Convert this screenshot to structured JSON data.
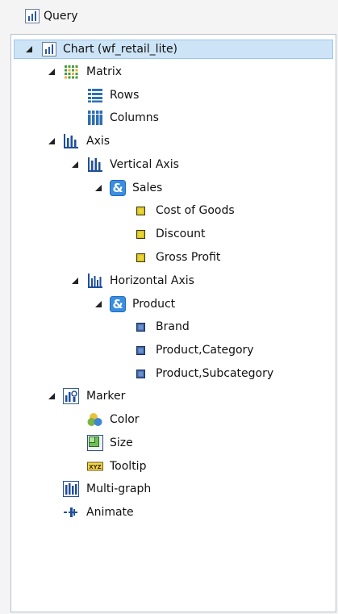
{
  "header": {
    "title": "Query"
  },
  "tree": {
    "chart": "Chart (wf_retail_lite)",
    "matrix": "Matrix",
    "rows": "Rows",
    "columns": "Columns",
    "axis": "Axis",
    "vertical_axis": "Vertical Axis",
    "sales": "Sales",
    "cost_of_goods": "Cost of Goods",
    "discount": "Discount",
    "gross_profit": "Gross Profit",
    "horizontal_axis": "Horizontal Axis",
    "product": "Product",
    "brand": "Brand",
    "product_category": "Product,Category",
    "product_subcategory": "Product,Subcategory",
    "marker": "Marker",
    "color": "Color",
    "size": "Size",
    "tooltip": "Tooltip",
    "tooltip_icon_text": "XYZ",
    "multigraph": "Multi-graph",
    "animate": "Animate"
  },
  "colors": {
    "selected_bg": "#cde4f7",
    "measure_yellow": "#d9c21a",
    "dimension_blue": "#3b63a8",
    "group_blue": "#2e7fd6"
  }
}
